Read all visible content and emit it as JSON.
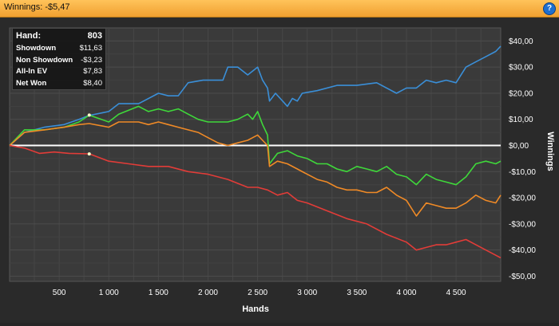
{
  "window": {
    "title": "Winnings: -$5,47",
    "help_icon": "help-icon",
    "help_label": "?"
  },
  "stats": {
    "header": {
      "label": "Hand:",
      "value": "803"
    },
    "rows": [
      {
        "label": "Showdown",
        "value": "$11,63"
      },
      {
        "label": "Non Showdown",
        "value": "-$3,23"
      },
      {
        "label": "All-In EV",
        "value": "$7,83"
      },
      {
        "label": "Net Won",
        "value": "$8,40"
      }
    ]
  },
  "chart_data": {
    "type": "line",
    "xlabel": "Hands",
    "ylabel": "Winnings",
    "xlim": [
      0,
      4950
    ],
    "ylim": [
      -52,
      45
    ],
    "x_ticks": [
      500,
      1000,
      1500,
      2000,
      2500,
      3000,
      3500,
      4000,
      4500
    ],
    "x_tick_labels": [
      "500",
      "1 000",
      "1 500",
      "2 000",
      "2 500",
      "3 000",
      "3 500",
      "4 000",
      "4 500"
    ],
    "y_ticks": [
      40,
      30,
      20,
      10,
      0,
      -10,
      -20,
      -30,
      -40,
      -50
    ],
    "y_tick_labels": [
      "$40,00",
      "$30,00",
      "$20,00",
      "$10,00",
      "$0,00",
      "-$10,00",
      "-$20,00",
      "-$30,00",
      "-$40,00",
      "-$50,00"
    ],
    "grid": true,
    "zero_line": true,
    "colors": {
      "blue": "#3a8fd8",
      "green": "#3fd83a",
      "orange": "#f08a26",
      "red": "#e23c38",
      "zero": "#ffffff"
    },
    "series": [
      {
        "color": "#3a8fd8",
        "x": [
          0,
          150,
          350,
          550,
          700,
          803,
          1000,
          1100,
          1300,
          1500,
          1600,
          1700,
          1800,
          1950,
          2050,
          2150,
          2200,
          2300,
          2400,
          2500,
          2550,
          2600,
          2620,
          2680,
          2800,
          2850,
          2900,
          2950,
          3100,
          3300,
          3500,
          3700,
          3900,
          4000,
          4100,
          4200,
          4300,
          4400,
          4500,
          4600,
          4700,
          4800,
          4900,
          4950
        ],
        "y": [
          0,
          5,
          7,
          8,
          10,
          11.5,
          13,
          16,
          16,
          20,
          19,
          19,
          24,
          25,
          25,
          25,
          30,
          30,
          27,
          30,
          25,
          22,
          17,
          20,
          15,
          18,
          17,
          20,
          21,
          23,
          23,
          24,
          20,
          22,
          22,
          25,
          24,
          25,
          24,
          30,
          32,
          34,
          36,
          38
        ]
      },
      {
        "color": "#3fd83a",
        "x": [
          0,
          150,
          350,
          550,
          700,
          803,
          1000,
          1100,
          1300,
          1400,
          1500,
          1600,
          1700,
          1800,
          1900,
          2000,
          2100,
          2200,
          2300,
          2400,
          2450,
          2500,
          2550,
          2600,
          2620,
          2700,
          2800,
          2900,
          3000,
          3100,
          3200,
          3300,
          3400,
          3500,
          3600,
          3700,
          3800,
          3900,
          4000,
          4100,
          4200,
          4300,
          4400,
          4500,
          4600,
          4700,
          4800,
          4900,
          4950
        ],
        "y": [
          0,
          6,
          6,
          7,
          9,
          11.6,
          9,
          12,
          15,
          13,
          14,
          13,
          14,
          12,
          10,
          9,
          9,
          9,
          10,
          12,
          10,
          13,
          8,
          4,
          -7,
          -3,
          -2,
          -4,
          -5,
          -7,
          -7,
          -9,
          -10,
          -8,
          -9,
          -10,
          -8,
          -11,
          -12,
          -15,
          -11,
          -13,
          -14,
          -15,
          -12,
          -7,
          -6,
          -7,
          -6
        ]
      },
      {
        "color": "#f08a26",
        "x": [
          0,
          150,
          350,
          550,
          700,
          803,
          1000,
          1100,
          1300,
          1400,
          1500,
          1600,
          1700,
          1800,
          1900,
          2000,
          2100,
          2200,
          2300,
          2400,
          2450,
          2500,
          2550,
          2600,
          2620,
          2700,
          2800,
          2900,
          3000,
          3100,
          3200,
          3300,
          3400,
          3500,
          3600,
          3700,
          3800,
          3900,
          4000,
          4100,
          4200,
          4300,
          4400,
          4500,
          4600,
          4700,
          4800,
          4900,
          4950
        ],
        "y": [
          0,
          5,
          6,
          7,
          8,
          8.4,
          7,
          9,
          9,
          8,
          9,
          8,
          7,
          6,
          5,
          3,
          1,
          0,
          1,
          2,
          3,
          4,
          2,
          0,
          -8,
          -6,
          -7,
          -9,
          -11,
          -13,
          -14,
          -16,
          -17,
          -17,
          -18,
          -18,
          -16,
          -19,
          -21,
          -27,
          -22,
          -23,
          -24,
          -24,
          -22,
          -19,
          -21,
          -22,
          -19
        ]
      },
      {
        "color": "#e23c38",
        "x": [
          0,
          150,
          300,
          450,
          600,
          803,
          1000,
          1200,
          1400,
          1600,
          1800,
          2000,
          2200,
          2400,
          2500,
          2600,
          2700,
          2800,
          2900,
          3000,
          3200,
          3400,
          3600,
          3800,
          4000,
          4100,
          4200,
          4300,
          4400,
          4500,
          4600,
          4700,
          4800,
          4900,
          4950
        ],
        "y": [
          0,
          -1,
          -3,
          -2.5,
          -3,
          -3.2,
          -6,
          -7,
          -8,
          -8,
          -10,
          -11,
          -13,
          -16,
          -16,
          -17,
          -19,
          -18,
          -21,
          -22,
          -25,
          -28,
          -30,
          -34,
          -37,
          -40,
          -39,
          -38,
          -38,
          -37,
          -36,
          -38,
          -40,
          -42,
          -43
        ]
      }
    ],
    "markers": [
      {
        "x": 803,
        "y": 11.63
      },
      {
        "x": 803,
        "y": -3.23
      }
    ]
  }
}
